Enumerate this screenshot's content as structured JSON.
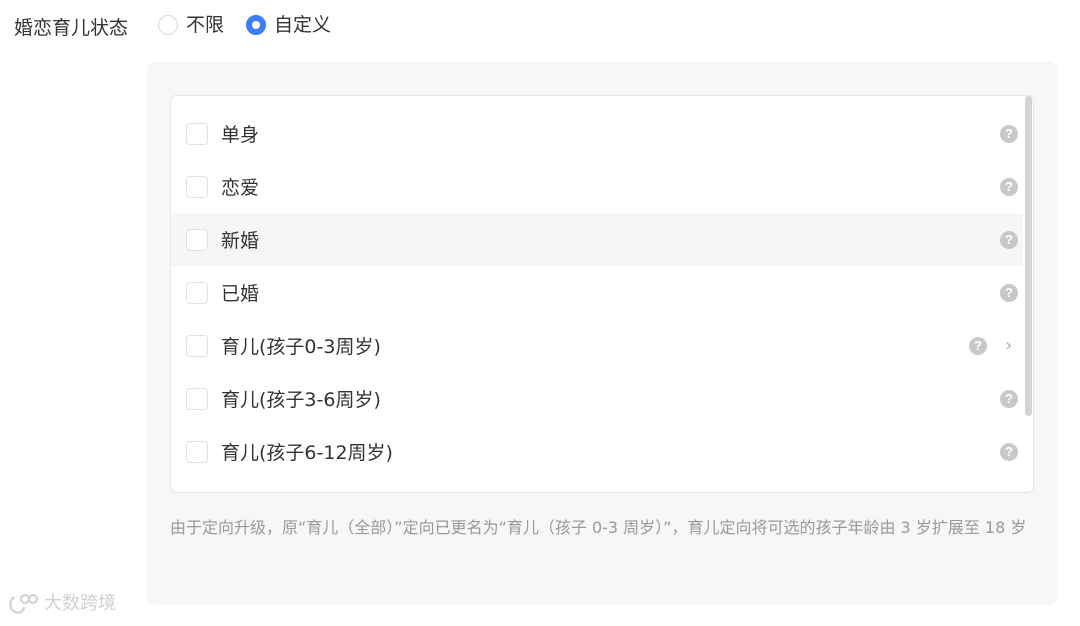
{
  "field": {
    "label": "婚恋育儿状态",
    "options": [
      {
        "label": "不限",
        "checked": false
      },
      {
        "label": "自定义",
        "checked": true
      }
    ]
  },
  "list": {
    "items": [
      {
        "label": "单身",
        "checked": false,
        "has_submenu": false
      },
      {
        "label": "恋爱",
        "checked": false,
        "has_submenu": false
      },
      {
        "label": "新婚",
        "checked": false,
        "has_submenu": false,
        "hovered": true
      },
      {
        "label": "已婚",
        "checked": false,
        "has_submenu": false
      },
      {
        "label": "育儿(孩子0-3周岁)",
        "checked": false,
        "has_submenu": true
      },
      {
        "label": "育儿(孩子3-6周岁)",
        "checked": false,
        "has_submenu": false
      },
      {
        "label": "育儿(孩子6-12周岁)",
        "checked": false,
        "has_submenu": false
      }
    ],
    "help_glyph": "?",
    "chevron_glyph": "›"
  },
  "note": "由于定向升级，原“育儿（全部）”定向已更名为“育儿（孩子 0-3 周岁）”，育儿定向将可选的孩子年龄由 3 岁扩展至 18 岁",
  "watermark": {
    "text": "大数跨境"
  },
  "colors": {
    "accent": "#3d7cf5",
    "muted_text": "#999999",
    "panel_bg": "#f7f7f7"
  }
}
